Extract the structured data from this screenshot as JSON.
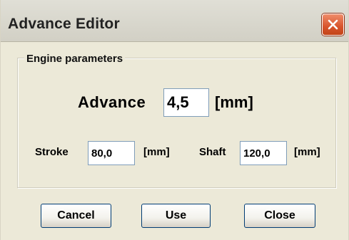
{
  "window": {
    "title": "Advance Editor"
  },
  "group": {
    "legend": "Engine parameters"
  },
  "advance": {
    "label": "Advance",
    "value": "4,5",
    "unit": "[mm]"
  },
  "stroke": {
    "label": "Stroke",
    "value": "80,0",
    "unit": "[mm]"
  },
  "shaft": {
    "label": "Shaft",
    "value": "120,0",
    "unit": "[mm]"
  },
  "buttons": {
    "cancel": "Cancel",
    "use": "Use",
    "close": "Close"
  },
  "colors": {
    "window_bg": "#ece9d8",
    "close_button": "#d8542c",
    "field_border": "#7f9db9",
    "button_border": "#003c74"
  },
  "icons": {
    "close": "close-icon"
  }
}
